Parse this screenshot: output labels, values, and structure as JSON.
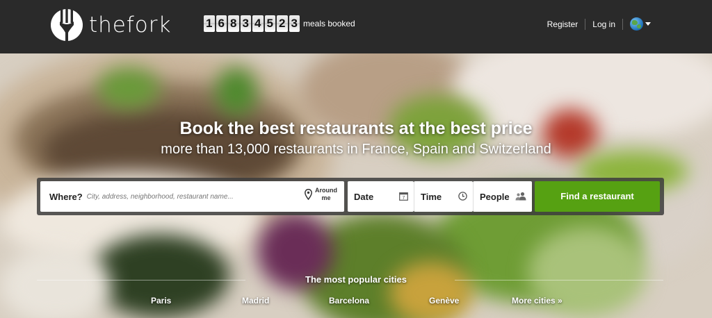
{
  "header": {
    "brand": "thefork",
    "counter_digits": [
      "1",
      "6",
      "8",
      "3",
      "4",
      "5",
      "2",
      "3"
    ],
    "counter_label": "meals booked",
    "nav": {
      "register": "Register",
      "login": "Log in"
    },
    "language_icon": "globe-icon"
  },
  "hero": {
    "headline": "Book the best restaurants at the best price",
    "subline": "more than 13,000 restaurants in France, Spain and Switzerland"
  },
  "search": {
    "where_label": "Where?",
    "where_placeholder": "City, address, neighborhood, restaurant name...",
    "around_me": [
      "Around",
      "me"
    ],
    "date_label": "Date",
    "time_label": "Time",
    "people_label": "People",
    "submit_label": "Find a restaurant",
    "submit_color": "#56a112"
  },
  "popular": {
    "title": "The most popular cities",
    "cities": [
      "Paris",
      "Madrid",
      "Barcelona",
      "Genève",
      "More cities »"
    ]
  }
}
